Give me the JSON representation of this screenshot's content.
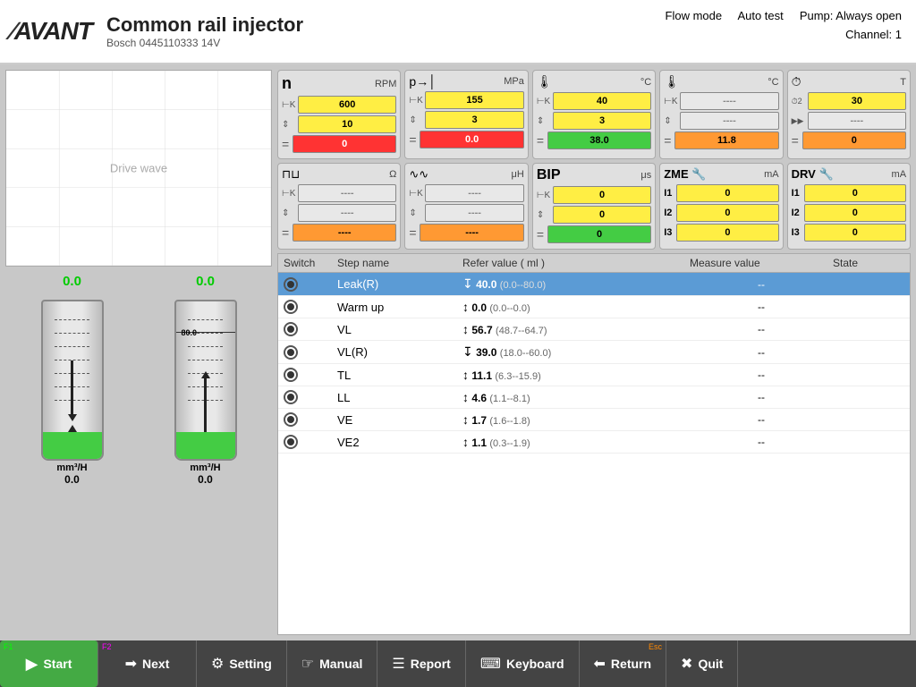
{
  "header": {
    "logo": "AVANT",
    "title": "Common rail injector",
    "subtitle": "Bosch  0445110333  14V",
    "flow_mode": "Flow mode",
    "auto_test": "Auto test",
    "pump": "Pump: Always open",
    "channel": "Channel: 1"
  },
  "drive_wave": {
    "label": "Drive wave"
  },
  "cylinders": [
    {
      "top_value": "0.0",
      "bottom_value": "0.0",
      "unit": "mm³/H",
      "marker": "0.0",
      "liquid_height": "30"
    },
    {
      "top_value": "0.0",
      "bottom_value": "0.0",
      "unit": "mm³/H",
      "marker": "80.0",
      "liquid_height": "30"
    }
  ],
  "instruments_row1": [
    {
      "icon": "n",
      "unit": "RPM",
      "set_val": "600",
      "step_val": "10",
      "cur_val": "0",
      "cur_color": "red"
    },
    {
      "icon": "p",
      "unit": "MPa",
      "set_val": "155",
      "step_val": "3",
      "cur_val": "0.0",
      "cur_color": "red"
    },
    {
      "icon": "temp1",
      "unit": "°C",
      "set_val": "40",
      "step_val": "3",
      "cur_val": "38.0",
      "cur_color": "green"
    },
    {
      "icon": "temp2",
      "unit": "°C",
      "set_val": "----",
      "step_val": "----",
      "cur_val": "11.8",
      "cur_color": "orange"
    },
    {
      "icon": "clock",
      "unit": "T",
      "set_val": "30",
      "step_val": "----",
      "cur_val": "0",
      "cur_color": "orange"
    }
  ],
  "instruments_row2": [
    {
      "icon": "resistor",
      "unit": "Ω",
      "set_val": "----",
      "step_val": "----",
      "cur_val": "----",
      "cur_color": "orange"
    },
    {
      "icon": "inductor",
      "unit": "μH",
      "set_val": "----",
      "step_val": "----",
      "cur_val": "----",
      "cur_color": "orange"
    },
    {
      "icon": "BIP",
      "unit": "μs",
      "l1_set": "0",
      "l2_set": "0",
      "l1_cur": "0",
      "cur_color": "green"
    },
    {
      "icon": "ZME",
      "unit": "mA",
      "l1": "0",
      "l2": "0",
      "l3": "0"
    },
    {
      "icon": "DRV",
      "unit": "mA",
      "l1": "0",
      "l2": "0",
      "l3": "0"
    }
  ],
  "table": {
    "headers": [
      "Switch",
      "Step name",
      "Refer value ( ml )",
      "Measure value",
      "State"
    ],
    "rows": [
      {
        "radio": true,
        "name": "Leak(R)",
        "ref_icon": "↓",
        "ref_val": "40.0",
        "ref_range": "(0.0--80.0)",
        "measure": "--",
        "state": "",
        "active": true
      },
      {
        "radio": true,
        "name": "Warm up",
        "ref_icon": "↕",
        "ref_val": "0.0",
        "ref_range": "(0.0--0.0)",
        "measure": "--",
        "state": ""
      },
      {
        "radio": true,
        "name": "VL",
        "ref_icon": "↕",
        "ref_val": "56.7",
        "ref_range": "(48.7--64.7)",
        "measure": "--",
        "state": ""
      },
      {
        "radio": true,
        "name": "VL(R)",
        "ref_icon": "↓",
        "ref_val": "39.0",
        "ref_range": "(18.0--60.0)",
        "measure": "--",
        "state": ""
      },
      {
        "radio": true,
        "name": "TL",
        "ref_icon": "↕",
        "ref_val": "11.1",
        "ref_range": "(6.3--15.9)",
        "measure": "--",
        "state": ""
      },
      {
        "radio": true,
        "name": "LL",
        "ref_icon": "↕",
        "ref_val": "4.6",
        "ref_range": "(1.1--8.1)",
        "measure": "--",
        "state": ""
      },
      {
        "radio": true,
        "name": "VE",
        "ref_icon": "↕",
        "ref_val": "1.7",
        "ref_range": "(1.6--1.8)",
        "measure": "--",
        "state": ""
      },
      {
        "radio": true,
        "name": "VE2",
        "ref_icon": "↕",
        "ref_val": "1.1",
        "ref_range": "(0.3--1.9)",
        "measure": "--",
        "state": ""
      }
    ]
  },
  "footer": {
    "f1_label": "F1",
    "f2_label": "F2",
    "esc_label": "Esc",
    "start_label": "Start",
    "next_label": "Next",
    "setting_label": "Setting",
    "manual_label": "Manual",
    "report_label": "Report",
    "keyboard_label": "Keyboard",
    "return_label": "Return",
    "quit_label": "Quit"
  }
}
